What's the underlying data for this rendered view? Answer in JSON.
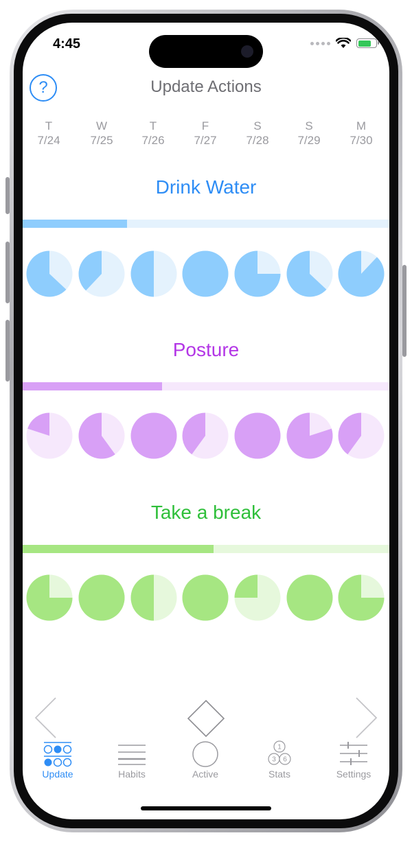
{
  "status": {
    "time": "4:45"
  },
  "header": {
    "title": "Update Actions",
    "help_icon": "help-circle-icon",
    "help_label": "?"
  },
  "days": [
    {
      "dow": "T",
      "date": "7/24"
    },
    {
      "dow": "W",
      "date": "7/25"
    },
    {
      "dow": "T",
      "date": "7/26"
    },
    {
      "dow": "F",
      "date": "7/27"
    },
    {
      "dow": "S",
      "date": "7/28"
    },
    {
      "dow": "S",
      "date": "7/29"
    },
    {
      "dow": "M",
      "date": "7/30"
    }
  ],
  "habits": [
    {
      "name": "Drink Water",
      "title_color": "#2e8df5",
      "fill_color": "#8ecdfd",
      "track_color": "#e4f2fd",
      "progress": 0.285,
      "completion": [
        0.63,
        0.38,
        0.5,
        1.0,
        0.75,
        0.63,
        0.88
      ]
    },
    {
      "name": "Posture",
      "title_color": "#b336e6",
      "fill_color": "#d8a0f6",
      "track_color": "#f6e8fc",
      "progress": 0.38,
      "completion": [
        0.2,
        0.6,
        1.0,
        0.4,
        1.0,
        0.8,
        0.4
      ]
    },
    {
      "name": "Take a break",
      "title_color": "#2fbf3a",
      "fill_color": "#a6e682",
      "track_color": "#e6f8dc",
      "progress": 0.52,
      "completion": [
        0.75,
        1.0,
        0.5,
        1.0,
        0.25,
        1.0,
        0.75
      ]
    }
  ],
  "navigation": {
    "prev_icon": "chevron-left-icon",
    "today_icon": "diamond-icon",
    "next_icon": "chevron-right-icon"
  },
  "tabs": [
    {
      "label": "Update",
      "icon": "update-dots-icon",
      "active": true
    },
    {
      "label": "Habits",
      "icon": "list-lines-icon",
      "active": false
    },
    {
      "label": "Active",
      "icon": "circle-icon",
      "active": false
    },
    {
      "label": "Stats",
      "icon": "stats-circles-icon",
      "active": false,
      "badges": [
        "1",
        "3",
        "6"
      ]
    },
    {
      "label": "Settings",
      "icon": "sliders-icon",
      "active": false
    }
  ]
}
